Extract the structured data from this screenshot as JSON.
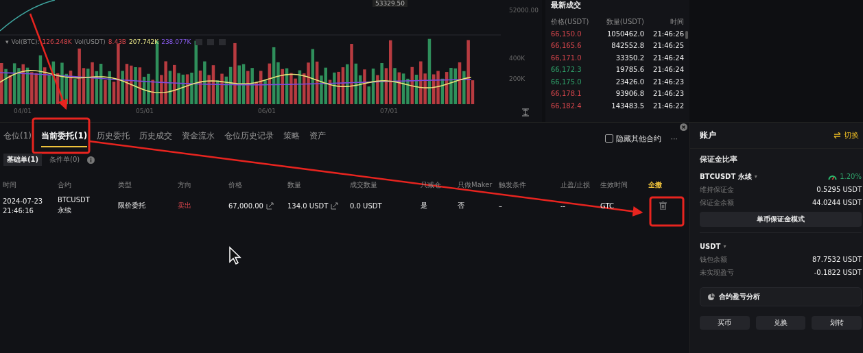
{
  "chart": {
    "price_tag": "53329.50",
    "price_axis": [
      "52000.00"
    ],
    "legend": {
      "caret": "▾",
      "vol_btc_label": "Vol(BTC):",
      "vol_btc": "126.248K",
      "vol_usdt_label": "Vol(USDT)",
      "vol_usdt": "8.43B",
      "ma1": "207.742K",
      "ma2": "238.077K"
    },
    "volume_axis": [
      "400K",
      "200K"
    ],
    "dates": [
      "04/01",
      "05/01",
      "06/01",
      "07/01"
    ]
  },
  "trades": {
    "title": "最新成交",
    "columns": [
      "价格(USDT)",
      "数量(USDT)",
      "时间"
    ],
    "rows": [
      {
        "price": "66,150.0",
        "amount": "1050462.0",
        "time": "21:46:26",
        "color": "#d9464c"
      },
      {
        "price": "66,165.6",
        "amount": "842552.8",
        "time": "21:46:25",
        "color": "#d9464c"
      },
      {
        "price": "66,171.0",
        "amount": "33350.2",
        "time": "21:46:24",
        "color": "#d9464c"
      },
      {
        "price": "66,172.3",
        "amount": "19785.6",
        "time": "21:46:24",
        "color": "#2fa36b"
      },
      {
        "price": "66,175.0",
        "amount": "23426.0",
        "time": "21:46:23",
        "color": "#2fa36b"
      },
      {
        "price": "66,178.1",
        "amount": "93906.8",
        "time": "21:46:23",
        "color": "#d9464c"
      },
      {
        "price": "66,182.4",
        "amount": "143483.5",
        "time": "21:46:22",
        "color": "#d9464c"
      }
    ]
  },
  "orders": {
    "tabs": [
      {
        "label": "仓位(1)",
        "selected": false
      },
      {
        "label": "当前委托(1)",
        "selected": true
      },
      {
        "label": "历史委托",
        "selected": false
      },
      {
        "label": "历史成交",
        "selected": false
      },
      {
        "label": "资金流水",
        "selected": false
      },
      {
        "label": "仓位历史记录",
        "selected": false
      },
      {
        "label": "策略",
        "selected": false
      },
      {
        "label": "资产",
        "selected": false
      }
    ],
    "hide_others": {
      "label": "隐藏其他合约",
      "checked": false
    },
    "more": "···",
    "subtabs": [
      {
        "label": "基础单(1)",
        "selected": true
      },
      {
        "label": "条件单(0)",
        "selected": false
      }
    ],
    "columns": [
      "时间",
      "合约",
      "类型",
      "方向",
      "价格",
      "数量",
      "成交数量",
      "只减仓",
      "只做Maker",
      "触发条件",
      "止盈/止损",
      "生效时间"
    ],
    "cancel_all": "全撤",
    "rows": [
      {
        "date": "2024-07-23",
        "time": "21:46:16",
        "symbol": "BTCUSDT",
        "contract": "永续",
        "type": "限价委托",
        "side": "卖出",
        "price": "67,000.00",
        "quantity": "134.0 USDT",
        "filled": "0.0 USDT",
        "reduce_only": "是",
        "post_only": "否",
        "trigger": "–",
        "tp_sl": "--",
        "tif": "GTC"
      }
    ]
  },
  "account": {
    "title": "账户",
    "switch": "切换",
    "margin_title": "保证金比率",
    "symbol": "BTCUSDT 永续",
    "symbol_caret": "▾",
    "ratio": "1.20%",
    "margin_rows": [
      {
        "label": "维持保证金",
        "value": "0.5295 USDT"
      },
      {
        "label": "保证金余额",
        "value": "44.0244 USDT"
      }
    ],
    "mode_button": "单币保证金模式",
    "currency": "USDT",
    "currency_caret": "▾",
    "wallet_rows": [
      {
        "label": "钱包余额",
        "value": "87.7532 USDT"
      },
      {
        "label": "未实现盈亏",
        "value": "-0.1822 USDT"
      }
    ],
    "analysis": "合约盈亏分析",
    "buttons": [
      "买币",
      "兑换",
      "划转"
    ]
  }
}
